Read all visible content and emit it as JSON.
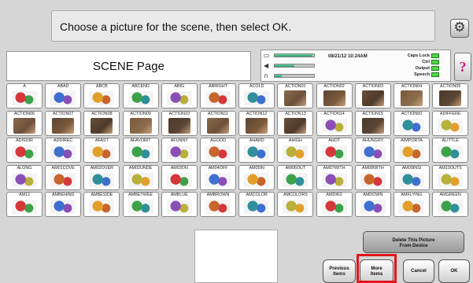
{
  "prompt": "Choose a picture for the scene, then select OK.",
  "page_title": "SCENE Page",
  "status": {
    "datetime": "08/21/12 10:24AM",
    "indicators": [
      "Caps Lock",
      "Ctrl",
      "Output",
      "Speech"
    ],
    "meters": [
      {
        "icon": "battery-icon",
        "level": 0.95
      },
      {
        "icon": "speaker-icon",
        "level": 0.5
      },
      {
        "icon": "headphones-icon",
        "level": 0.18
      }
    ]
  },
  "help_label": "?",
  "tiles": [
    [
      "A",
      "ABAD",
      "ABCB",
      "ABCEND",
      "ABIG",
      "ABRIGHT",
      "ACOLD",
      "ACTION01",
      "ACTION02",
      "ACTION03",
      "ACTION04",
      "ACTION05"
    ],
    [
      "ACTION06",
      "ACTION07",
      "ACTION08",
      "ACTION09",
      "ACTION10",
      "ACTION11",
      "ACTION12",
      "ACTION13",
      "ACTION14",
      "ACTION15",
      "ACTION50",
      "ADIFFERE"
    ],
    [
      "ADISDIR",
      "ADDIREC",
      "AFAST",
      "AFAVORIT",
      "AFUNNY",
      "AGOOD",
      "AHARD",
      "AHIGH",
      "AHOT",
      "AHUNGRY",
      "AIMPORTA",
      "ALITTLE"
    ],
    [
      "ALONG",
      "AM01COVE",
      "AM02OVER",
      "AM02UNDE",
      "AM03ON",
      "AM04OFF",
      "AM05IN",
      "AM06OUT",
      "AM07WITH",
      "AM08WITH",
      "AM09INSI",
      "AM10OUTS"
    ],
    [
      "AM12",
      "AMBEHIND",
      "AMBESIDE",
      "AMBETWEE",
      "AMBLUE",
      "AMBROWN",
      "AMCOLOR",
      "AMCOLORS",
      "AMDIR2",
      "AMDOWN",
      "AMFLYING",
      "AMGREEN"
    ]
  ],
  "buttons": {
    "delete": [
      "Delete This Picture",
      "From Device"
    ],
    "previous": [
      "Previous",
      "Items"
    ],
    "more": [
      "More",
      "Items"
    ],
    "cancel": "Cancel",
    "ok": "OK"
  }
}
